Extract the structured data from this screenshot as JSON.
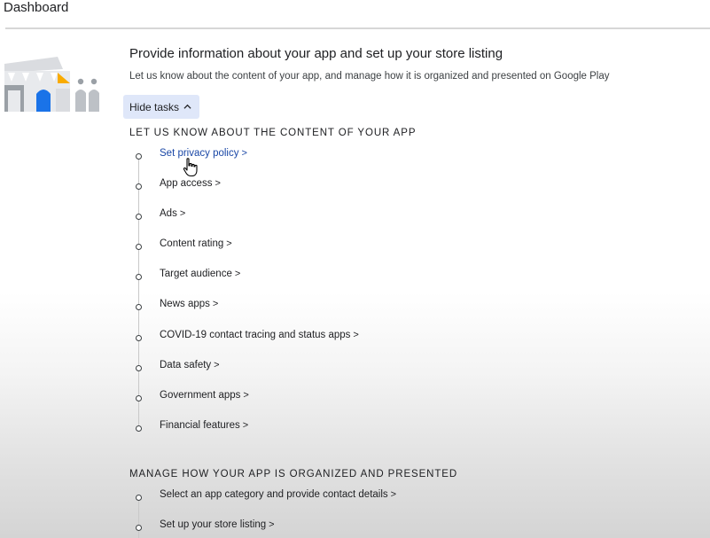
{
  "topbar": {
    "title": "Dashboard"
  },
  "header": {
    "heading": "Provide information about your app and set up your store listing",
    "subtext": "Let us know about the content of your app, and manage how it is organized and presented on Google Play"
  },
  "hide_tasks": {
    "label": "Hide tasks"
  },
  "sections": [
    {
      "title": "LET US KNOW ABOUT THE CONTENT OF YOUR APP",
      "tasks": [
        {
          "label": "Set privacy policy",
          "arrow": ">"
        },
        {
          "label": "App access",
          "arrow": ">"
        },
        {
          "label": "Ads",
          "arrow": ">"
        },
        {
          "label": "Content rating",
          "arrow": ">"
        },
        {
          "label": "Target audience",
          "arrow": ">"
        },
        {
          "label": "News apps",
          "arrow": ">"
        },
        {
          "label": "COVID-19 contact tracing and status apps",
          "arrow": ">"
        },
        {
          "label": "Data safety",
          "arrow": ">"
        },
        {
          "label": "Government apps",
          "arrow": ">"
        },
        {
          "label": "Financial features",
          "arrow": ">"
        }
      ]
    },
    {
      "title": "MANAGE HOW YOUR APP IS ORGANIZED AND PRESENTED",
      "tasks": [
        {
          "label": "Select an app category and provide contact details",
          "arrow": ">"
        },
        {
          "label": "Set up your store listing",
          "arrow": ">"
        }
      ]
    }
  ],
  "colors": {
    "link_blue": "#1a47a6",
    "button_bg": "#dfe7f9",
    "illustration_blue": "#1a73e8",
    "illustration_yellow": "#f9ab00",
    "illustration_gray": "#bdc1c6"
  },
  "icons": {
    "hide_tasks": "chevron-up-icon",
    "task_status": "circle-outline-icon",
    "pointer": "hand-cursor-icon"
  }
}
